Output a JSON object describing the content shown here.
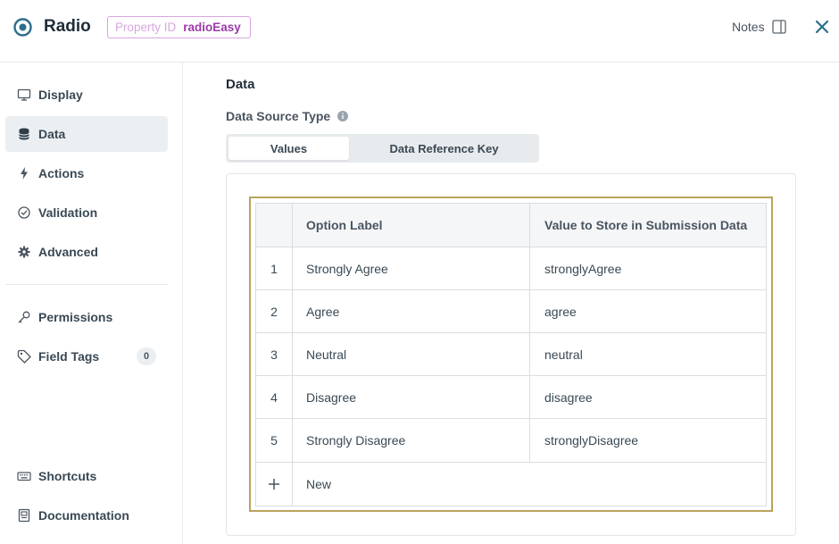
{
  "header": {
    "title": "Radio",
    "property_id_label": "Property ID",
    "property_id_value": "radioEasy",
    "notes_label": "Notes"
  },
  "sidebar": {
    "items": [
      {
        "label": "Display",
        "icon": "monitor-icon"
      },
      {
        "label": "Data",
        "icon": "database-icon",
        "active": true
      },
      {
        "label": "Actions",
        "icon": "lightning-icon"
      },
      {
        "label": "Validation",
        "icon": "check-circle-icon"
      },
      {
        "label": "Advanced",
        "icon": "gear-icon"
      },
      {
        "label": "Permissions",
        "icon": "key-icon"
      },
      {
        "label": "Field Tags",
        "icon": "tag-icon",
        "count": "0"
      },
      {
        "label": "Shortcuts",
        "icon": "keyboard-icon"
      },
      {
        "label": "Documentation",
        "icon": "document-icon"
      }
    ]
  },
  "main": {
    "section_title": "Data",
    "data_source_label": "Data Source Type",
    "tabs": [
      {
        "label": "Values",
        "selected": true
      },
      {
        "label": "Data Reference Key",
        "selected": false
      }
    ],
    "table": {
      "columns": [
        "Option Label",
        "Value to Store in Submission Data"
      ],
      "rows": [
        {
          "num": "1",
          "label": "Strongly Agree",
          "value": "stronglyAgree"
        },
        {
          "num": "2",
          "label": "Agree",
          "value": "agree"
        },
        {
          "num": "3",
          "label": "Neutral",
          "value": "neutral"
        },
        {
          "num": "4",
          "label": "Disagree",
          "value": "disagree"
        },
        {
          "num": "5",
          "label": "Strongly Disagree",
          "value": "stronglyDisagree"
        }
      ],
      "new_label": "New"
    }
  },
  "colors": {
    "accent": "#2c6e8a",
    "badge_border": "#d9a6e0",
    "badge_value": "#9b3aa8",
    "table_focus_border": "#b9a35e"
  }
}
